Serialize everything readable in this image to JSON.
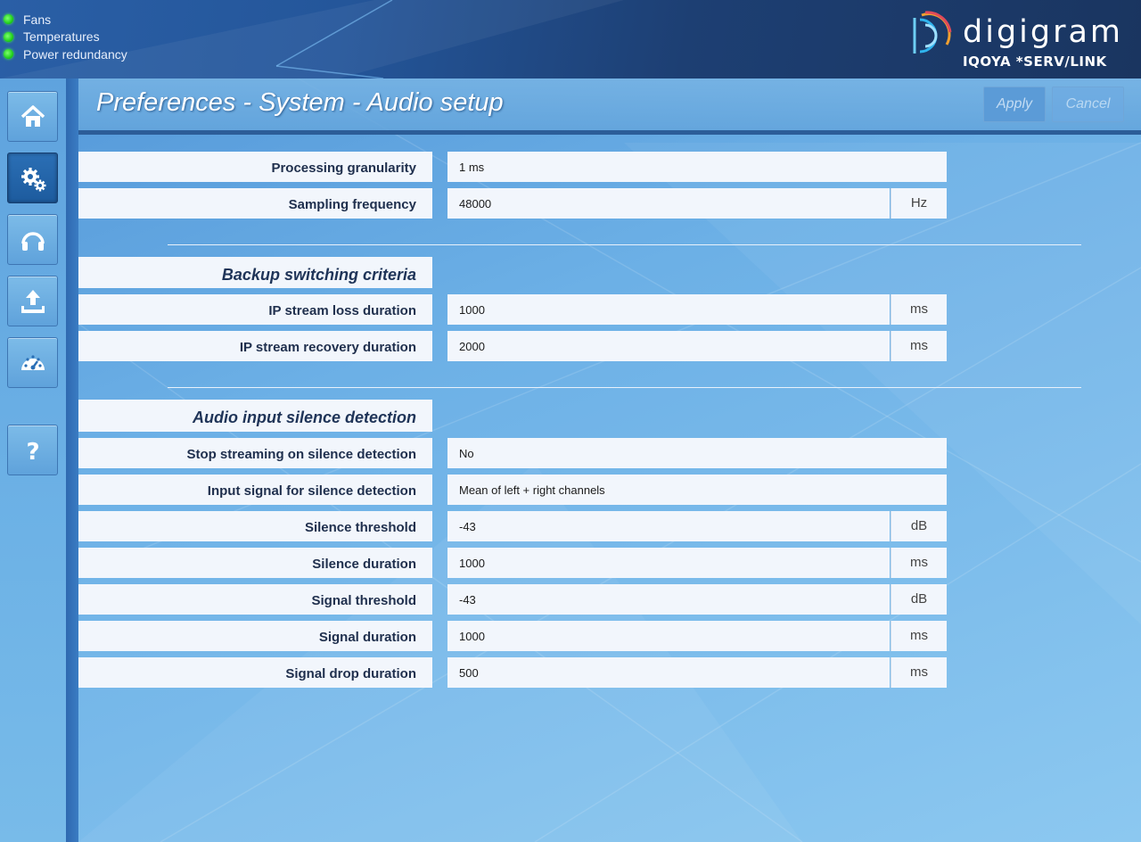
{
  "status": {
    "items": [
      {
        "label": "Fans",
        "color": "#22d11c"
      },
      {
        "label": "Temperatures",
        "color": "#22d11c"
      },
      {
        "label": "Power redundancy",
        "color": "#22d11c"
      }
    ]
  },
  "brand": {
    "name": "digigram",
    "product": "IQOYA *SERV/LINK"
  },
  "sidebar": {
    "items": [
      {
        "icon": "home-icon",
        "active": false
      },
      {
        "icon": "gears-icon",
        "active": true
      },
      {
        "icon": "headphones-icon",
        "active": false
      },
      {
        "icon": "upload-icon",
        "active": false
      },
      {
        "icon": "gauge-icon",
        "active": false
      },
      {
        "icon": "help-icon",
        "active": false
      }
    ]
  },
  "page": {
    "title": "Preferences - System - Audio setup",
    "apply_label": "Apply",
    "cancel_label": "Cancel"
  },
  "general": {
    "processing_granularity": {
      "label": "Processing granularity",
      "value": "1 ms"
    },
    "sampling_frequency": {
      "label": "Sampling frequency",
      "value": "48000",
      "unit": "Hz"
    }
  },
  "backup": {
    "section_title": "Backup switching criteria",
    "ip_stream_loss": {
      "label": "IP stream loss duration",
      "value": "1000",
      "unit": "ms"
    },
    "ip_stream_recovery": {
      "label": "IP stream recovery duration",
      "value": "2000",
      "unit": "ms"
    }
  },
  "silence": {
    "section_title": "Audio input silence detection",
    "stop_streaming": {
      "label": "Stop streaming on silence detection",
      "value": "No"
    },
    "input_signal": {
      "label": "Input signal for silence detection",
      "value": "Mean of left + right channels"
    },
    "silence_threshold": {
      "label": "Silence threshold",
      "value": "-43",
      "unit": "dB"
    },
    "silence_duration": {
      "label": "Silence duration",
      "value": "1000",
      "unit": "ms"
    },
    "signal_threshold": {
      "label": "Signal threshold",
      "value": "-43",
      "unit": "dB"
    },
    "signal_duration": {
      "label": "Signal duration",
      "value": "1000",
      "unit": "ms"
    },
    "signal_drop_duration": {
      "label": "Signal drop duration",
      "value": "500",
      "unit": "ms"
    }
  }
}
